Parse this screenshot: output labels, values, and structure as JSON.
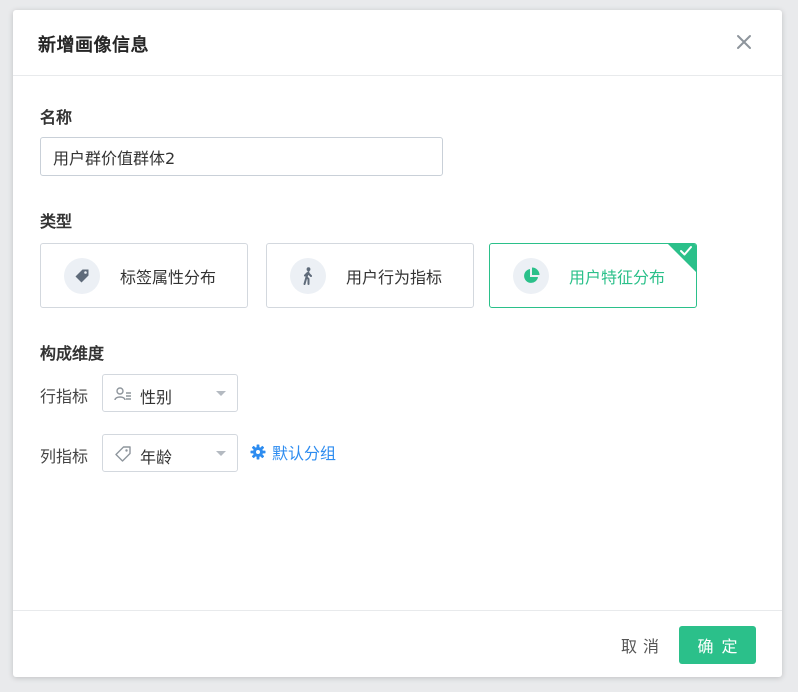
{
  "dialog": {
    "title": "新增画像信息",
    "close_icon": "close-icon"
  },
  "form": {
    "name_label": "名称",
    "name_value": "用户群价值群体2",
    "type_label": "类型",
    "types": [
      {
        "label": "标签属性分布",
        "icon": "tag-icon",
        "selected": false
      },
      {
        "label": "用户行为指标",
        "icon": "walking-person-icon",
        "selected": false
      },
      {
        "label": "用户特征分布",
        "icon": "pie-chart-icon",
        "selected": true
      }
    ],
    "dimension_label": "构成维度",
    "row_indicator": {
      "label": "行指标",
      "icon": "user-list-icon",
      "value": "性别"
    },
    "col_indicator": {
      "label": "列指标",
      "icon": "tag-outline-icon",
      "value": "年龄"
    },
    "group_link": {
      "icon": "gear-icon",
      "label": "默认分组"
    }
  },
  "footer": {
    "cancel_label": "取消",
    "ok_label": "确定"
  },
  "colors": {
    "accent": "#2bc08a",
    "link": "#2d8cf0",
    "border": "#d3d8de"
  }
}
